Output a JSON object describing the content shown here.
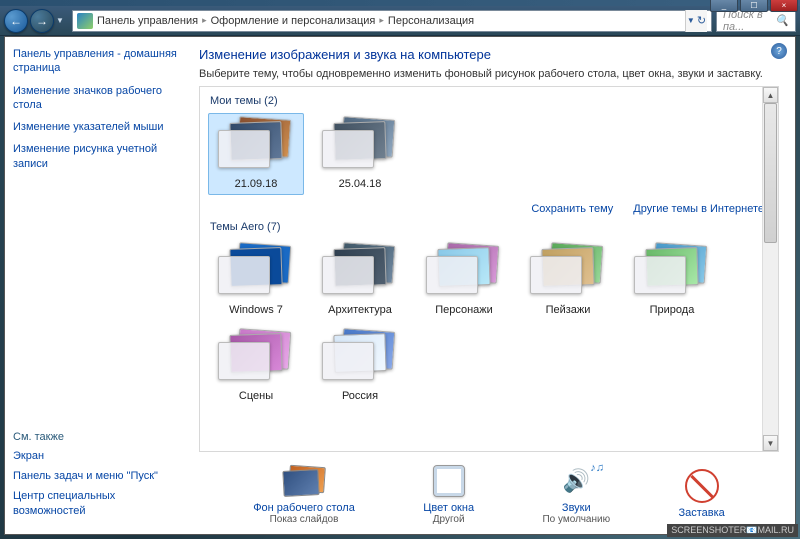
{
  "window": {
    "title_controls": {
      "min": "_",
      "max": "☐",
      "close": "×"
    }
  },
  "nav": {
    "back": "←",
    "forward": "→",
    "dropdown": "▼",
    "refresh": "↻"
  },
  "breadcrumb": {
    "item1": "Панель управления",
    "item2": "Оформление и персонализация",
    "item3": "Персонализация",
    "sep": "▸"
  },
  "search": {
    "placeholder": "Поиск в па...",
    "icon": "🔍"
  },
  "sidebar": {
    "links": [
      "Панель управления - домашняя страница",
      "Изменение значков рабочего стола",
      "Изменение указателей мыши",
      "Изменение рисунка учетной записи"
    ],
    "also_header": "См. также",
    "also_links": [
      "Экран",
      "Панель задач и меню \"Пуск\"",
      "Центр специальных возможностей"
    ]
  },
  "content": {
    "heading": "Изменение изображения и звука на компьютере",
    "subtitle": "Выберите тему, чтобы одновременно изменить фоновый рисунок рабочего стола, цвет окна, звуки и заставку.",
    "help": "?"
  },
  "sections": {
    "my_themes": {
      "label": "Мои темы (2)",
      "items": [
        "21.09.18",
        "25.04.18"
      ]
    },
    "aero": {
      "label": "Темы Aero (7)",
      "items": [
        "Windows 7",
        "Архитектура",
        "Персонажи",
        "Пейзажи",
        "Природа",
        "Сцены",
        "Россия"
      ]
    },
    "links": {
      "save": "Сохранить тему",
      "more": "Другие темы в Интернете"
    }
  },
  "bottom": {
    "bg": {
      "label": "Фон рабочего стола",
      "sub": "Показ слайдов"
    },
    "color": {
      "label": "Цвет окна",
      "sub": "Другой"
    },
    "sound": {
      "label": "Звуки",
      "sub": "По умолчанию",
      "icon": "🔊"
    },
    "saver": {
      "label": "Заставка"
    }
  },
  "theme_colors": {
    "my": [
      [
        "linear-gradient(135deg,#8a5030,#d09050)",
        "linear-gradient(135deg,#304868,#607898)"
      ],
      [
        "linear-gradient(135deg,#506880,#90a8c0)",
        "linear-gradient(135deg,#405060,#708090)"
      ]
    ],
    "aero": [
      [
        "#1a6ac4",
        "#0a4a9a"
      ],
      [
        "linear-gradient(135deg,#405868,#7088a0)",
        "linear-gradient(135deg,#304050,#506070)"
      ],
      [
        "linear-gradient(135deg,#a868a8,#d898d8)",
        "linear-gradient(135deg,#88c8e8,#b8e8f8)"
      ],
      [
        "linear-gradient(135deg,#58a858,#98d898)",
        "linear-gradient(135deg,#c0a060,#e0c090)"
      ],
      [
        "linear-gradient(135deg,#4898c8,#88c8e8)",
        "linear-gradient(135deg,#68b868,#a8e8a8)"
      ],
      [
        "linear-gradient(135deg,#c878c8,#e8a8e8)",
        "linear-gradient(135deg,#a858a8,#d888d8)"
      ],
      [
        "linear-gradient(135deg,#4878c8,#88a8e8)",
        "linear-gradient(135deg,#d8e8f8,#f0f8ff)"
      ]
    ]
  },
  "watermark": "SCREENSHOTER📧MAIL.RU"
}
